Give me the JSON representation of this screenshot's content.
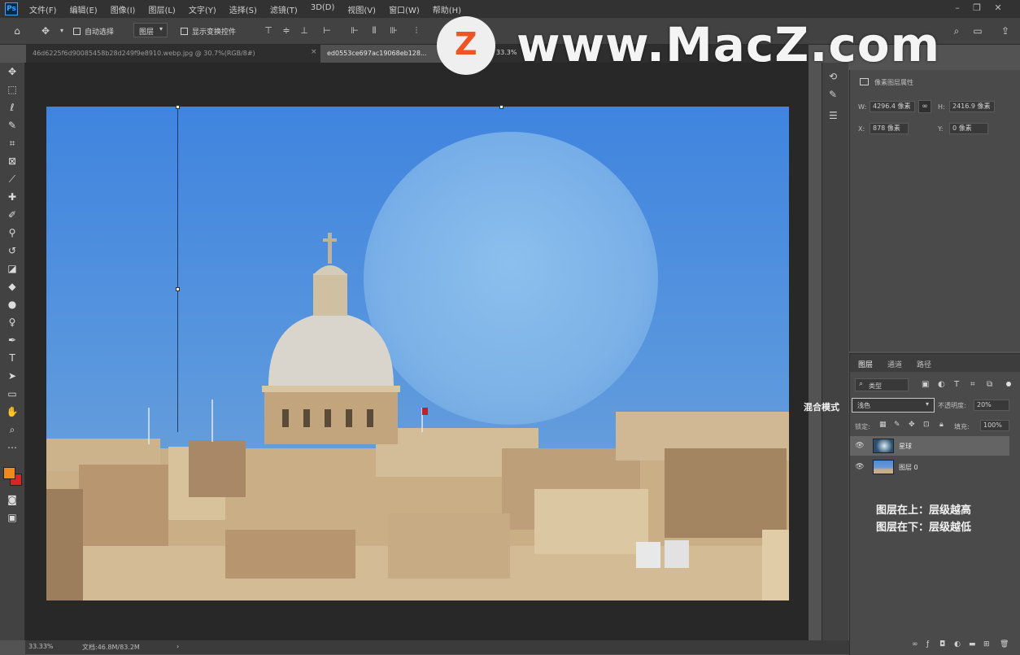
{
  "app": {
    "logo": "Ps"
  },
  "menu": [
    "文件(F)",
    "编辑(E)",
    "图像(I)",
    "图层(L)",
    "文字(Y)",
    "选择(S)",
    "滤镜(T)",
    "3D(D)",
    "视图(V)",
    "窗口(W)",
    "帮助(H)"
  ],
  "options_bar": {
    "auto_select_label": "自动选择",
    "auto_select_target": "图层",
    "show_transform_label": "显示变换控件"
  },
  "doc_tabs": [
    {
      "label": "46d6225f6d90085458b28d249f9e8910.webp.jpg @ 30.7%(RGB/8#)",
      "active": false
    },
    {
      "label": "ed0553ce697ac19068eb128...",
      "active": true
    }
  ],
  "doc_zoom_partial": "33.3%",
  "watermark": {
    "letter": "Z",
    "text": "www.MacZ.com"
  },
  "properties": {
    "header": "像素图层属性",
    "w_label": "W:",
    "w_value": "4296.4 像素",
    "h_label": "H:",
    "h_value": "2416.9 像素",
    "x_label": "X:",
    "x_value": "878 像素",
    "y_label": "Y:",
    "y_value": "0 像素"
  },
  "layers_panel": {
    "tabs": [
      "图层",
      "通道",
      "路径"
    ],
    "filter_kind": "类型",
    "blend_mode_annotation": "混合模式",
    "blend_mode": "浅色",
    "opacity_label": "不透明度:",
    "opacity_value": "20%",
    "lock_label": "锁定:",
    "fill_label": "填充:",
    "fill_value": "100%",
    "layers": [
      {
        "name": "星球",
        "selected": true,
        "thumb_color": "#2b4f6e"
      },
      {
        "name": "图层 0",
        "selected": false,
        "thumb_color": "#6a9ad4"
      }
    ],
    "note_line1": "图层在上：层级越高",
    "note_line2": "图层在下：层级越低"
  },
  "status": {
    "zoom": "33.33%",
    "doc_info": "文档:46.8M/83.2M"
  },
  "colors": {
    "foreground": "#f08a1c",
    "background": "#d62525"
  }
}
